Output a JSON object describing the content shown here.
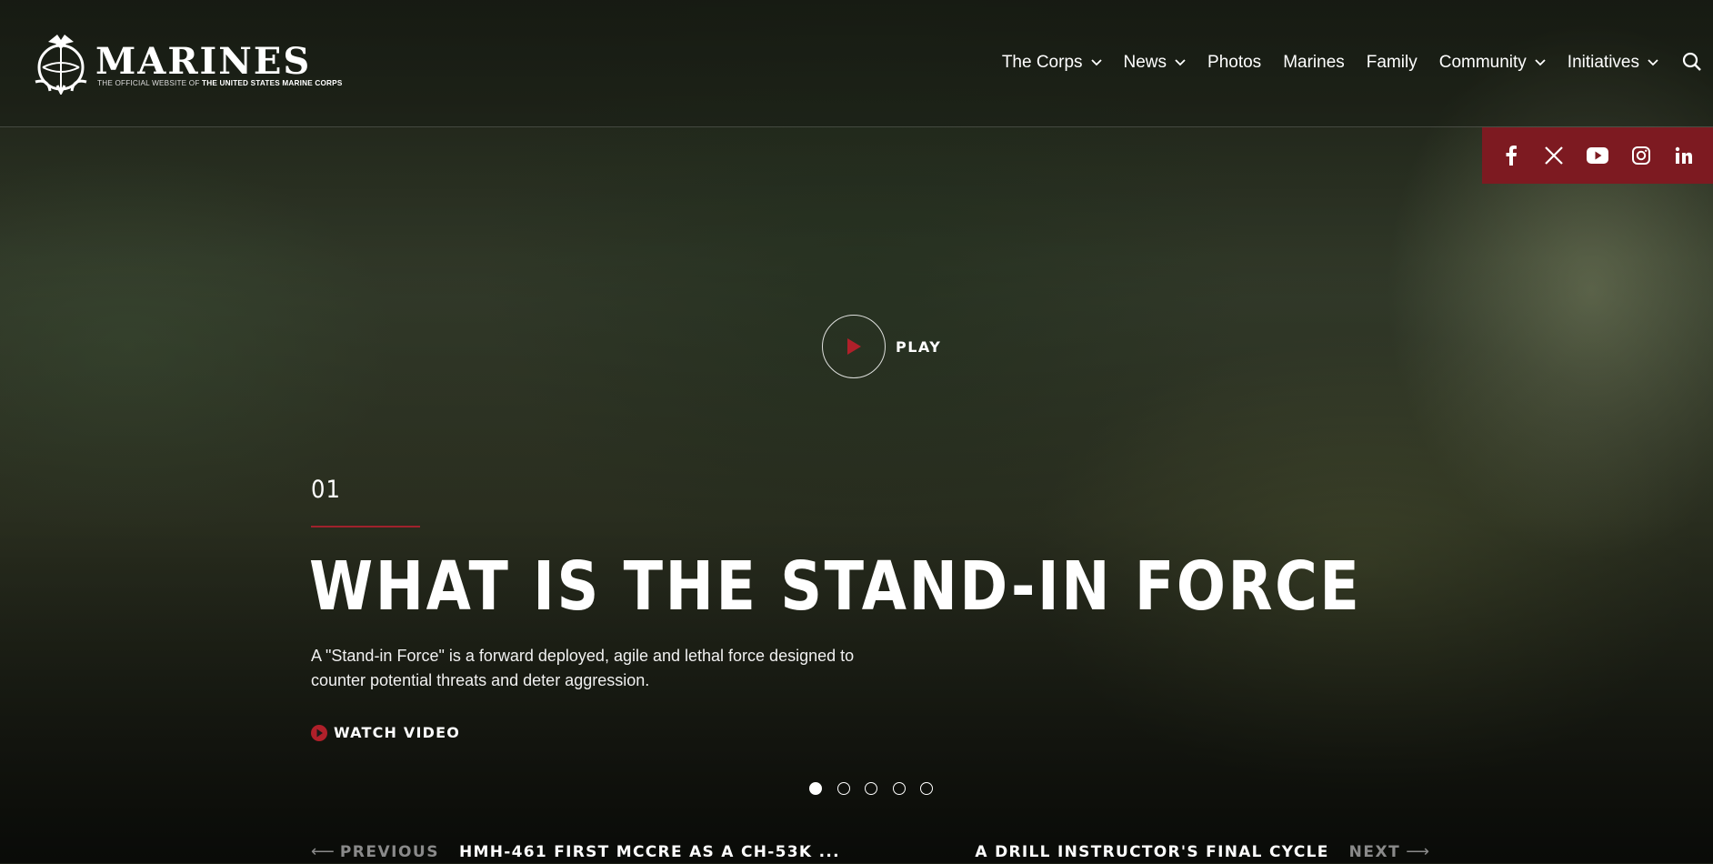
{
  "brand": {
    "wordmark": "MARINES",
    "tagline_prefix": "THE OFFICIAL WEBSITE OF",
    "tagline_strong": "THE UNITED STATES MARINE CORPS"
  },
  "nav": {
    "items": [
      {
        "label": "The Corps",
        "has_dropdown": true
      },
      {
        "label": "News",
        "has_dropdown": true
      },
      {
        "label": "Photos",
        "has_dropdown": false
      },
      {
        "label": "Marines",
        "has_dropdown": false
      },
      {
        "label": "Family",
        "has_dropdown": false
      },
      {
        "label": "Community",
        "has_dropdown": true
      },
      {
        "label": "Initiatives",
        "has_dropdown": true
      }
    ],
    "search_icon": "search-icon"
  },
  "social": {
    "background": "#7d1a21",
    "icons": [
      "facebook-icon",
      "x-icon",
      "youtube-icon",
      "instagram-icon",
      "linkedin-icon"
    ]
  },
  "hero": {
    "play_label": "PLAY",
    "slide_number": "01",
    "title": "WHAT IS THE STAND-IN FORCE",
    "description": "A \"Stand-in Force\" is a forward deployed, agile and lethal force designed to counter potential threats and deter aggression.",
    "watch_label": "WATCH VIDEO",
    "accent_color": "#a0212c",
    "slide_count": 5,
    "active_slide": 1
  },
  "pager": {
    "prev_arrow": "⟵",
    "prev_label": "PREVIOUS",
    "prev_title": "HMH-461 FIRST MCCRE AS A CH-53K ...",
    "next_title": "A DRILL INSTRUCTOR'S FINAL CYCLE",
    "next_label": "NEXT",
    "next_arrow": "⟶"
  }
}
